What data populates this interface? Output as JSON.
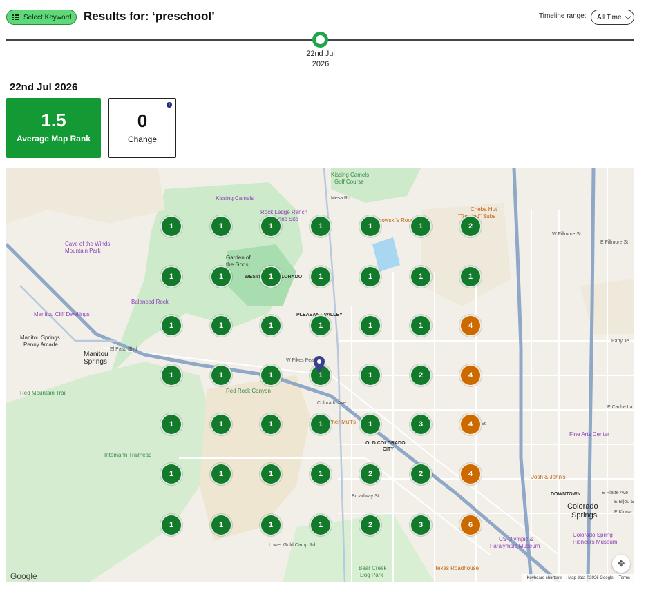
{
  "header": {
    "select_keyword_label": "Select Keyword",
    "results_title": "Results for: ‘preschool’",
    "timeline_label": "Timeline range:",
    "timeline_value": "All Time"
  },
  "timeline": {
    "date_line1": "22nd Jul",
    "date_line2": "2026"
  },
  "summary": {
    "date_heading": "22nd Jul 2026",
    "average_rank_value": "1.5",
    "average_rank_label": "Average Map Rank",
    "change_value": "0",
    "change_label": "Change",
    "info_icon": "info-icon"
  },
  "colors": {
    "rank_good": "#137a2c",
    "rank_mid": "#cc6a00",
    "accent": "#139a35"
  },
  "grid_ranks": [
    [
      "1",
      "1",
      "1",
      "1",
      "1",
      "1",
      "2"
    ],
    [
      "1",
      "1",
      "1",
      "1",
      "1",
      "1",
      "1"
    ],
    [
      "1",
      "1",
      "1",
      "1",
      "1",
      "1",
      "4"
    ],
    [
      "1",
      "1",
      "1",
      "1",
      "1",
      "2",
      "4"
    ],
    [
      "1",
      "1",
      "1",
      "1",
      "1",
      "3",
      "4"
    ],
    [
      "1",
      "1",
      "1",
      "1",
      "2",
      "2",
      "4"
    ],
    [
      "1",
      "1",
      "1",
      "1",
      "2",
      "3",
      "6"
    ]
  ],
  "map": {
    "labels": [
      "Kissing Camels Golf Course",
      "Kissing Camels",
      "Rock Ledge Ranch Historic Site",
      "Lebowski's Room",
      "Cheba Hut \"Toasted\" Subs",
      "Cave of the Winds Mountain Park",
      "Garden of the Gods",
      "WESTSIDE / COLORADO SPRINGS",
      "Balanced Rock",
      "PLEASANT VALLEY",
      "Manitou Cliff Dwellings",
      "Manitou Springs Penny Arcade",
      "Manitou Springs",
      "Red Rock Canyon",
      "Red Mountain Trail",
      "Mother Muff's",
      "OLD COLORADO CITY",
      "Intemann Trailhead",
      "Fine Arts Center",
      "Josh & John's",
      "DOWNTOWN",
      "Colorado Springs",
      "US Olympic & Paralympic Museum",
      "Colorado Springs Pioneers Museum",
      "Texas Roadhouse",
      "Bear Creek Dog Park",
      "Lower Gold Camp Rd",
      "Broadway St",
      "W Fillmore St",
      "E Fillmore St",
      "Colorado Ave",
      "W Pikes Peak Ave",
      "Mesa Rd",
      "El Paso Blvd",
      "Uintah St",
      "E Cache La Poudre St",
      "E Platte Ave",
      "E Bijou St",
      "E Kiowa St",
      "Patty Je"
    ],
    "attribution": {
      "google": "Google",
      "shortcuts": "Keyboard shortcuts",
      "map_data": "Map data ©2026 Google",
      "terms": "Terms"
    },
    "location_pin_icon": "map-pin-icon",
    "gesture_icon": "pan-control-icon"
  }
}
